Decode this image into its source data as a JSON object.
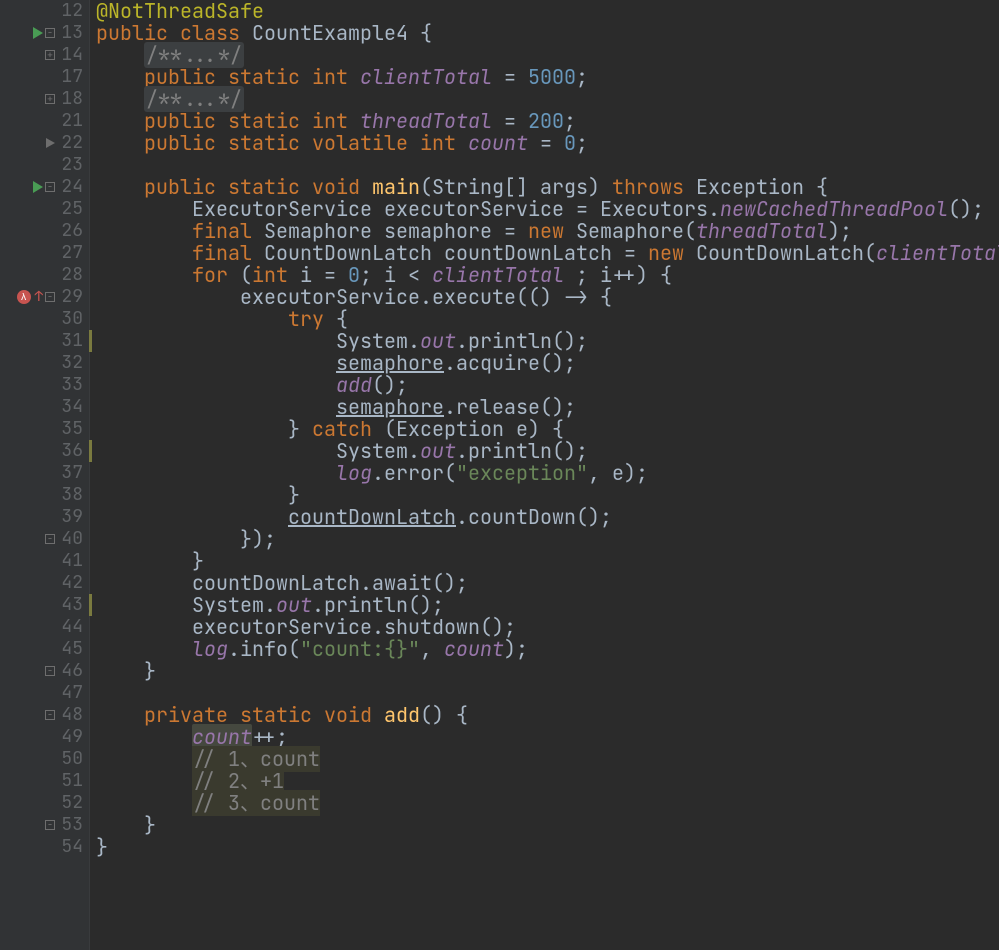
{
  "gutter": {
    "lines": [
      "12",
      "13",
      "14",
      "17",
      "18",
      "21",
      "22",
      "23",
      "24",
      "25",
      "26",
      "27",
      "28",
      "29",
      "30",
      "31",
      "32",
      "33",
      "34",
      "35",
      "36",
      "37",
      "38",
      "39",
      "40",
      "41",
      "42",
      "43",
      "44",
      "45",
      "46",
      "47",
      "48",
      "49",
      "50",
      "51",
      "52",
      "53",
      "54"
    ]
  },
  "code": {
    "l12": {
      "ann": "@NotThreadSafe"
    },
    "l13": {
      "kw1": "public",
      "kw2": "class",
      "name": "CountExample4",
      "brace": " {"
    },
    "l14": {
      "cmt": "/**...*/"
    },
    "l17": {
      "kw1": "public",
      "kw2": "static",
      "kw3": "int",
      "field": "clientTotal",
      "eq": " = ",
      "num": "5000",
      "semi": ";"
    },
    "l18": {
      "cmt": "/**...*/"
    },
    "l21": {
      "kw1": "public",
      "kw2": "static",
      "kw3": "int",
      "field": "threadTotal",
      "eq": " = ",
      "num": "200",
      "semi": ";"
    },
    "l22": {
      "kw1": "public",
      "kw2": "static",
      "kw3": "volatile",
      "kw4": "int",
      "field": "count",
      "eq": " = ",
      "num": "0",
      "semi": ";"
    },
    "l24": {
      "kw1": "public",
      "kw2": "static",
      "kw3": "void",
      "mname": "main",
      "sig1": "(String[] args) ",
      "kw4": "throws",
      "sig2": " Exception {"
    },
    "l25": {
      "t1": "ExecutorService executorService = Executors.",
      "m": "newCachedThreadPool",
      "t2": "();"
    },
    "l26": {
      "kw": "final",
      "t1": " Semaphore semaphore = ",
      "kw2": "new",
      "t2": " Semaphore(",
      "f": "threadTotal",
      "t3": ");"
    },
    "l27": {
      "kw": "final",
      "t1": " CountDownLatch countDownLatch = ",
      "kw2": "new",
      "t2": " CountDownLatch(",
      "f": "clientTotal",
      "t3": ");"
    },
    "l28": {
      "kw": "for",
      "t1": " (",
      "kw2": "int",
      "t2": " i = ",
      "n0": "0",
      "t3": "; i < ",
      "f": "clientTotal",
      "t4": " ; i++) {"
    },
    "l29": {
      "t1": "executorService.execute(() -> {"
    },
    "l30": {
      "kw": "try",
      "t": " {"
    },
    "l31": {
      "t1": "System.",
      "f": "out",
      "t2": ".println();"
    },
    "l32": {
      "u": "semaphore",
      "t": ".acquire();"
    },
    "l33": {
      "m": "add",
      "t": "();"
    },
    "l34": {
      "u": "semaphore",
      "t": ".release();"
    },
    "l35": {
      "t1": "} ",
      "kw": "catch",
      "t2": " (Exception e) {"
    },
    "l36": {
      "t1": "System.",
      "f": "out",
      "t2": ".println();"
    },
    "l37": {
      "f": "log",
      "t1": ".error(",
      "s": "\"exception\"",
      "t2": ", e);"
    },
    "l38": {
      "t": "}"
    },
    "l39": {
      "u": "countDownLatch",
      "t": ".countDown();"
    },
    "l40": {
      "t": "});"
    },
    "l41": {
      "t": "}"
    },
    "l42": {
      "t": "countDownLatch.await();"
    },
    "l43": {
      "t1": "System.",
      "f": "out",
      "t2": ".println();"
    },
    "l44": {
      "t": "executorService.shutdown();"
    },
    "l45": {
      "f": "log",
      "t1": ".info(",
      "s": "\"count:{}\"",
      "t2": ", ",
      "f2": "count",
      "t3": ");"
    },
    "l46": {
      "t": "}"
    },
    "l48": {
      "kw1": "private",
      "kw2": "static",
      "kw3": "void",
      "mname": "add",
      "t": "() {"
    },
    "l49": {
      "f": "count",
      "t": "++;"
    },
    "l50": {
      "c": "// 1、count"
    },
    "l51": {
      "c": "// 2、+1"
    },
    "l52": {
      "c": "// 3、count"
    },
    "l53": {
      "t": "}"
    },
    "l54": {
      "t": "}"
    }
  }
}
